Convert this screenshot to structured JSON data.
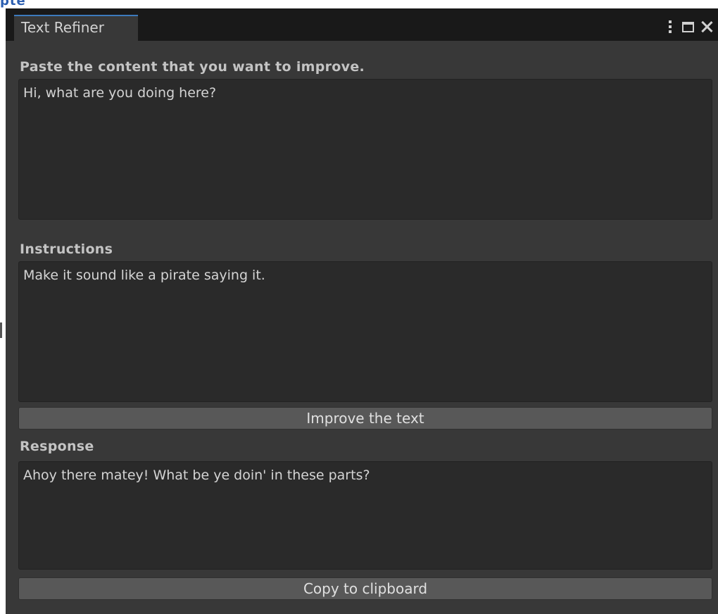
{
  "window": {
    "tab_title": "Text Refiner"
  },
  "content_section": {
    "label": "Paste the content that you want to improve.",
    "value": "Hi, what are you doing here?"
  },
  "instructions_section": {
    "label": "Instructions",
    "value": "Make it sound like a pirate saying it."
  },
  "improve_button": {
    "label": "Improve the text"
  },
  "response_section": {
    "label": "Response",
    "value": "Ahoy there matey! What be ye doin' in these parts?"
  },
  "copy_button": {
    "label": "Copy to clipboard"
  },
  "background_fragment": {
    "text": "pte"
  },
  "icons": {
    "menu": "kebab-menu-icon",
    "maximize": "maximize-icon",
    "close": "close-icon"
  }
}
